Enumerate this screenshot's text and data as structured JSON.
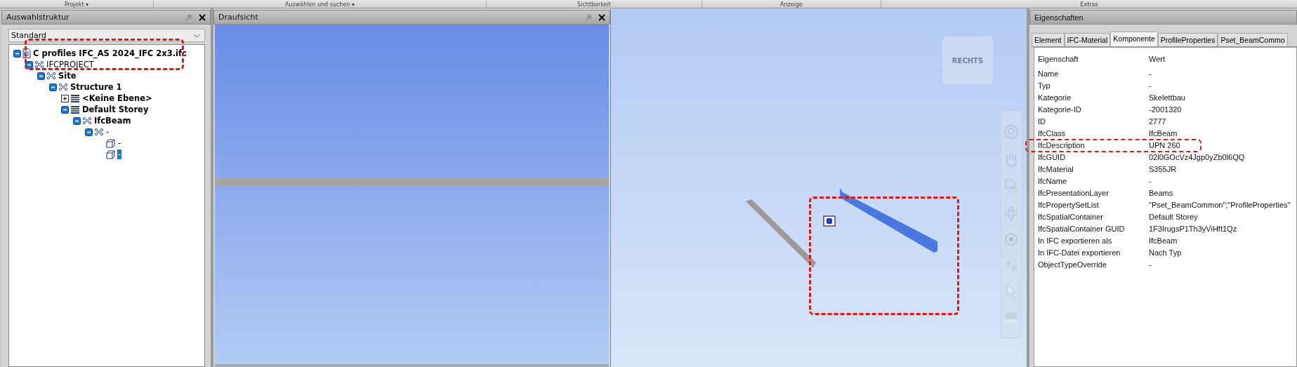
{
  "menu_bar": [
    {
      "label": "Projekt ▾"
    },
    {
      "label": "Auswählen und suchen ▾"
    },
    {
      "label": "Sichtbarkeit"
    },
    {
      "label": "Anzeige"
    },
    {
      "label": "Extras"
    }
  ],
  "selection_tree": {
    "title": "Auswahlstruktur",
    "dropdown": "Standard",
    "items": [
      {
        "label": "C profiles IFC_AS 2024_IFC 2x3.ifc",
        "kind": "file",
        "bold": true,
        "expanded": true,
        "selected": false,
        "children": [
          {
            "label": "IFCPROJECT",
            "kind": "group",
            "bold": false,
            "expanded": true,
            "selected": false,
            "children": [
              {
                "label": "Site",
                "kind": "group",
                "bold": true,
                "expanded": true,
                "selected": false,
                "children": [
                  {
                    "label": "Structure 1",
                    "kind": "group",
                    "bold": true,
                    "expanded": true,
                    "selected": false,
                    "children": [
                      {
                        "label": "<Keine Ebene>",
                        "kind": "layer",
                        "bold": true,
                        "expanded": false,
                        "selected": false
                      },
                      {
                        "label": "Default Storey",
                        "kind": "layer",
                        "bold": true,
                        "expanded": true,
                        "selected": false,
                        "children": [
                          {
                            "label": "IfcBeam",
                            "kind": "group",
                            "bold": true,
                            "expanded": true,
                            "selected": false,
                            "children": [
                              {
                                "label": "-",
                                "kind": "group",
                                "bold": false,
                                "expanded": true,
                                "selected": false,
                                "children": [
                                  {
                                    "label": "-",
                                    "kind": "solid",
                                    "bold": false,
                                    "selected": false
                                  },
                                  {
                                    "label": "-",
                                    "kind": "solid",
                                    "bold": false,
                                    "selected": true
                                  }
                                ]
                              }
                            ]
                          }
                        ]
                      }
                    ]
                  }
                ]
              }
            ]
          }
        ]
      }
    ]
  },
  "plan_view": {
    "title": "Draufsicht"
  },
  "viewport": {
    "viewcube_label": "RECHTS"
  },
  "properties": {
    "title": "Eigenschaften",
    "tabs": [
      {
        "label": "Element",
        "selected": false
      },
      {
        "label": "IFC-Material",
        "selected": false
      },
      {
        "label": "Komponente",
        "selected": true
      },
      {
        "label": "ProfileProperties",
        "selected": false
      },
      {
        "label": "Pset_BeamCommo",
        "selected": false
      }
    ],
    "columns": [
      "Eigenschaft",
      "Wert"
    ],
    "rows": [
      [
        "Name",
        "-"
      ],
      [
        "Typ",
        "-"
      ],
      [
        "Kategorie",
        "Skelettbau"
      ],
      [
        "Kategorie-ID",
        "-2001320"
      ],
      [
        "ID",
        "2777"
      ],
      [
        "IfcClass",
        "IfcBeam"
      ],
      [
        "IfcDescription",
        "UPN 260"
      ],
      [
        "IfcGUID",
        "02l0GOcVz4Jgp0yZb0l6QQ"
      ],
      [
        "IfcMaterial",
        "S355JR"
      ],
      [
        "IfcName",
        "-"
      ],
      [
        "IfcPresentationLayer",
        "Beams"
      ],
      [
        "IfcPropertySetList",
        "\"Pset_BeamCommon\";\"ProfileProperties\""
      ],
      [
        "IfcSpatialContainer",
        "Default Storey"
      ],
      [
        "IfcSpatialContainer GUID",
        "1F3IrugsP1Th3yViHft1Qz"
      ],
      [
        "In IFC exportieren als",
        "IfcBeam"
      ],
      [
        "In IFC-Datei exportieren",
        "Nach Typ"
      ],
      [
        "ObjectTypeOverride",
        "-"
      ]
    ]
  }
}
